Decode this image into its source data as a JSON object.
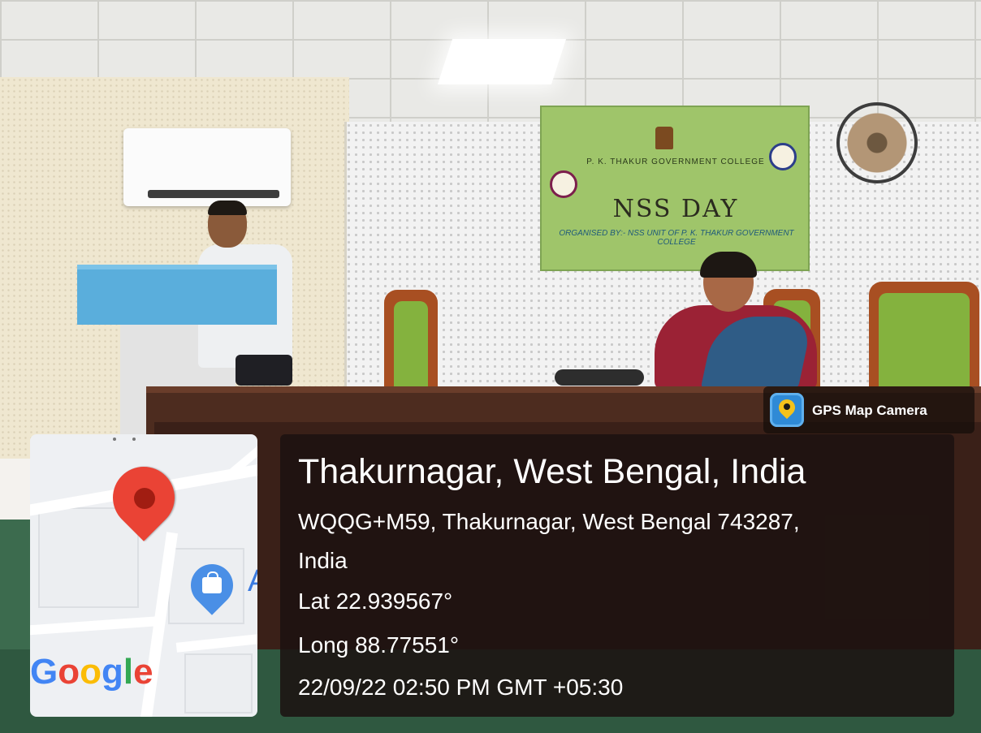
{
  "banner": {
    "college_name": "P. K. THAKUR GOVERNMENT COLLEGE",
    "event_title": "NSS DAY",
    "organized_by": "ORGANISED BY:- NSS UNIT OF P. K. THAKUR GOVERNMENT COLLEGE"
  },
  "gps_app": {
    "name": "GPS Map Camera",
    "icon": "map-pin-app-icon"
  },
  "map": {
    "brand": "Google",
    "partial_label": "A",
    "pin_icon": "location-pin-icon",
    "place_icon": "shopping-bag-icon",
    "pin_color": "#ea4335",
    "place_color": "#4a8fe6"
  },
  "location": {
    "title": "Thakurnagar, West Bengal, India",
    "address_line1": "WQQG+M59, Thakurnagar, West Bengal 743287,",
    "address_line2": "India",
    "latitude": "Lat 22.939567°",
    "longitude": "Long 88.77551°",
    "datetime": "22/09/22 02:50 PM GMT +05:30"
  }
}
